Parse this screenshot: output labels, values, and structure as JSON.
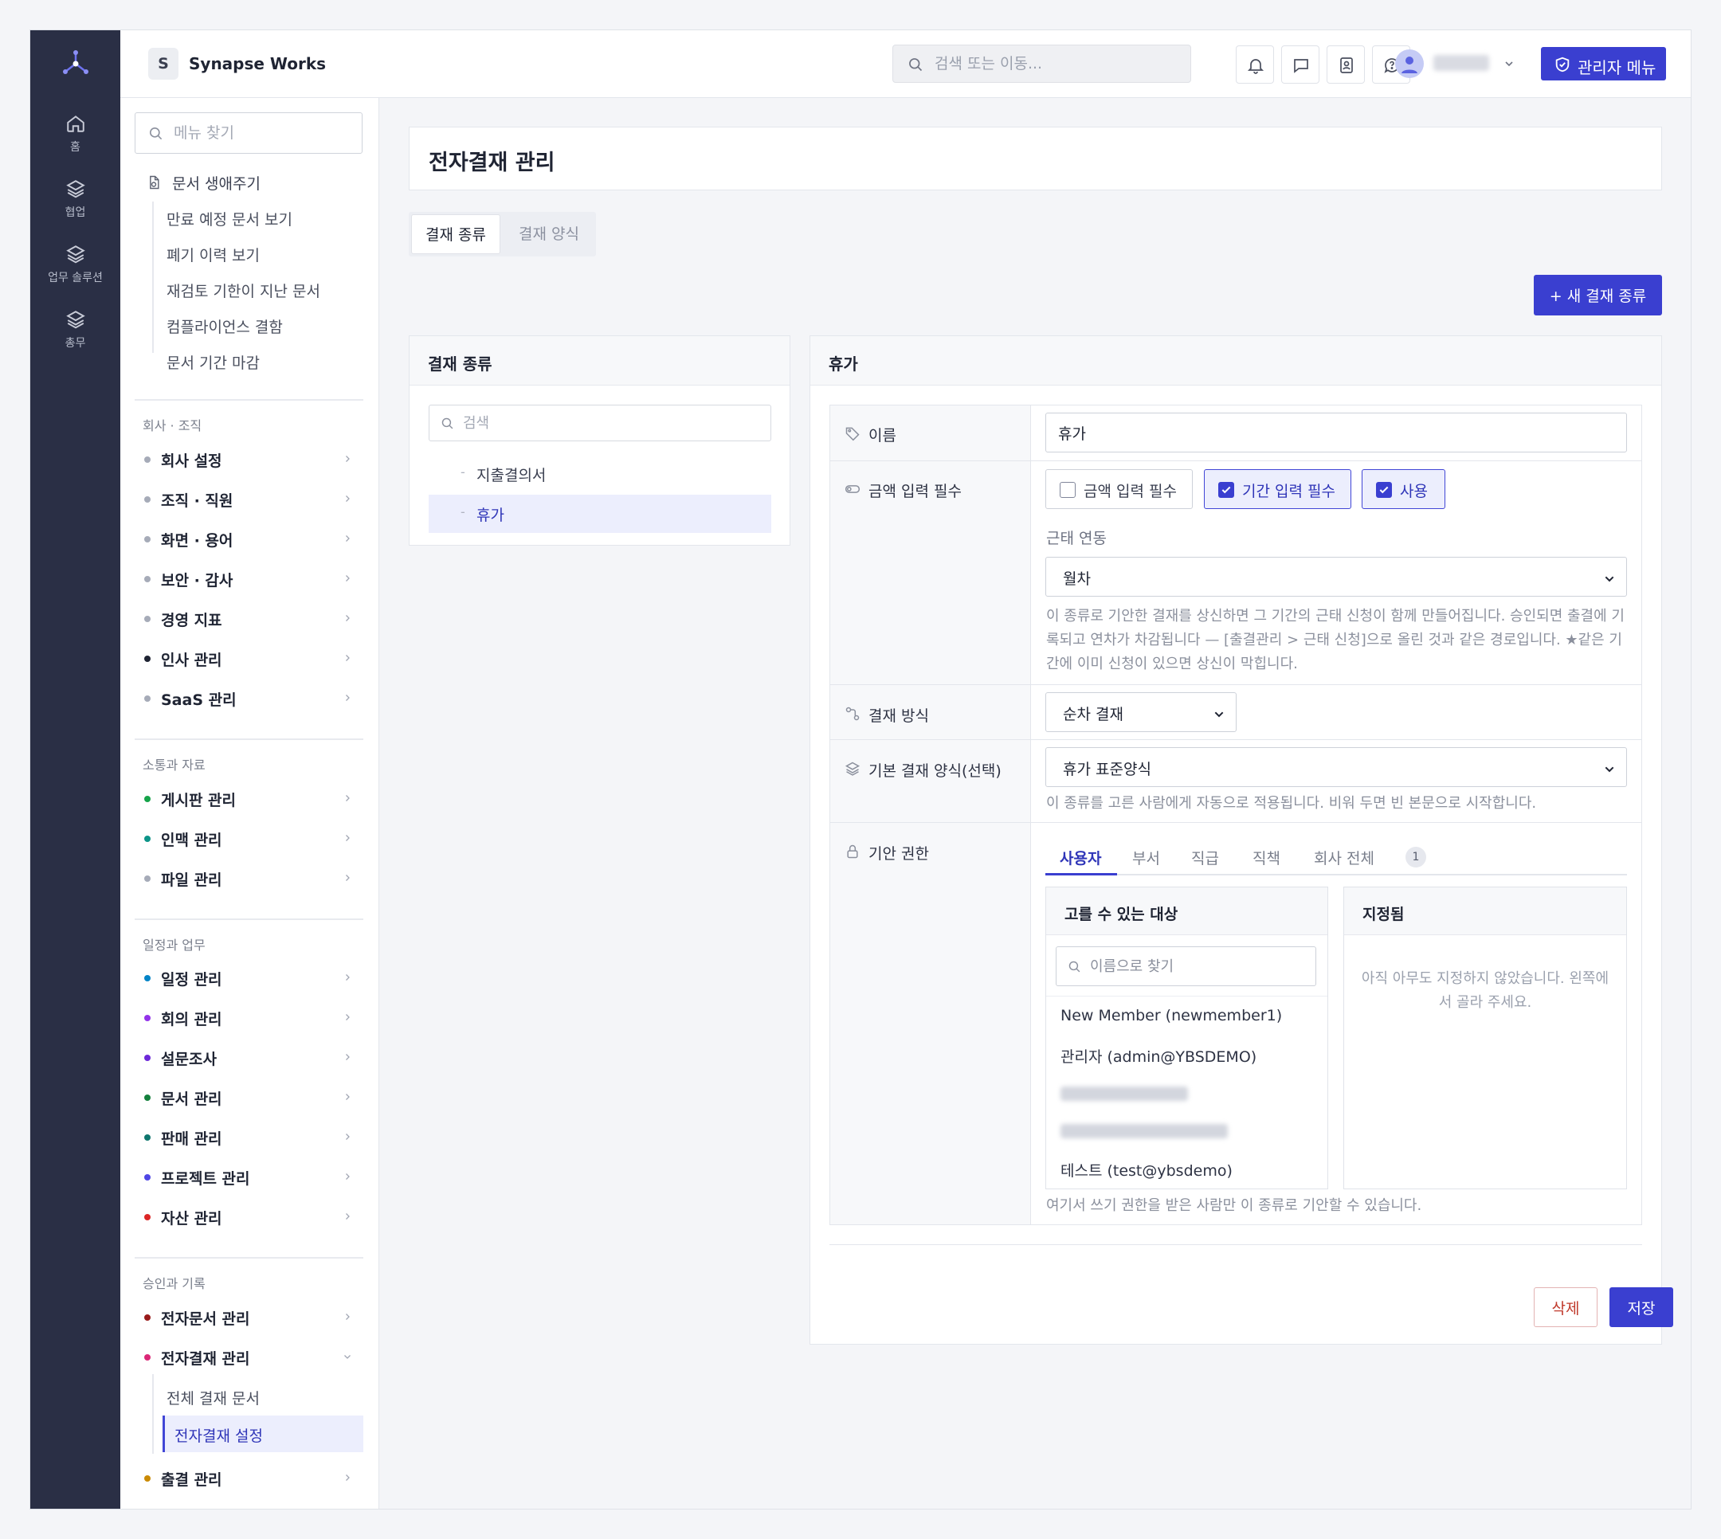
{
  "rail": {
    "items": [
      {
        "label": "홈",
        "icon": "home-icon"
      },
      {
        "label": "협업",
        "icon": "layers-icon"
      },
      {
        "label": "업무 솔루션",
        "icon": "layers-icon"
      },
      {
        "label": "총무",
        "icon": "layers-icon"
      }
    ]
  },
  "header": {
    "org_initial": "S",
    "org_name": "Synapse Works",
    "search_placeholder": "검색 또는 이동...",
    "admin_menu_label": "관리자 메뉴"
  },
  "sidebar": {
    "search_placeholder": "메뉴 찾기",
    "lifecycle": {
      "title": "문서 생애주기",
      "items": [
        "만료 예정 문서 보기",
        "폐기 이력 보기",
        "재검토 기한이 지난 문서",
        "컴플라이언스 결함",
        "문서 기간 마감"
      ]
    },
    "groups": [
      {
        "title": "회사 · 조직",
        "items": [
          {
            "label": "회사 설정",
            "color": "#a6abb8"
          },
          {
            "label": "조직 · 직원",
            "color": "#a6abb8"
          },
          {
            "label": "화면 · 용어",
            "color": "#a6abb8"
          },
          {
            "label": "보안 · 감사",
            "color": "#a6abb8"
          },
          {
            "label": "경영 지표",
            "color": "#a6abb8"
          },
          {
            "label": "인사 관리",
            "color": "#1f2433"
          },
          {
            "label": "SaaS 관리",
            "color": "#a6abb8"
          }
        ]
      },
      {
        "title": "소통과 자료",
        "items": [
          {
            "label": "게시판 관리",
            "color": "#16a34a"
          },
          {
            "label": "인맥 관리",
            "color": "#0d9488"
          },
          {
            "label": "파일 관리",
            "color": "#a6abb8"
          }
        ]
      },
      {
        "title": "일정과 업무",
        "items": [
          {
            "label": "일정 관리",
            "color": "#0284c7"
          },
          {
            "label": "회의 관리",
            "color": "#9333ea"
          },
          {
            "label": "설문조사",
            "color": "#6d28d9"
          },
          {
            "label": "문서 관리",
            "color": "#15803d"
          },
          {
            "label": "판매 관리",
            "color": "#0f766e"
          },
          {
            "label": "프로젝트 관리",
            "color": "#4f46e5"
          },
          {
            "label": "자산 관리",
            "color": "#dc2626"
          }
        ]
      },
      {
        "title": "승인과 기록",
        "items": [
          {
            "label": "전자문서 관리",
            "color": "#991b1b"
          },
          {
            "label": "전자결재 관리",
            "color": "#db2777"
          },
          {
            "label": "출결 관리",
            "color": "#ca8a04"
          }
        ]
      }
    ],
    "approval_sub": [
      "전체 결재 문서",
      "전자결재 설정"
    ]
  },
  "main": {
    "title": "전자결재 관리",
    "tabs": [
      "결재 종류",
      "결재 양식"
    ],
    "new_type_button": "+ 새 결재 종류",
    "type_list": {
      "title": "결재 종류",
      "search_placeholder": "검색",
      "items": [
        "지출결의서",
        "휴가"
      ],
      "dash": "-"
    },
    "detail": {
      "title": "휴가",
      "fields": {
        "name_label": "이름",
        "name_value": "휴가",
        "amount_label": "금액 입력 필수",
        "checks": [
          {
            "label": "금액 입력 필수",
            "checked": false
          },
          {
            "label": "기간 입력 필수",
            "checked": true
          },
          {
            "label": "사용",
            "checked": true
          }
        ],
        "attendance_label": "근태 연동",
        "attendance_value": "월차",
        "attendance_help": "이 종류로 기안한 결재를 상신하면 그 기간의 근태 신청이 함께 만들어집니다. 승인되면 출결에 기록되고 연차가 차감됩니다 — [출결관리 > 근태 신청]으로 올린 것과 같은 경로입니다. ★같은 기간에 이미 신청이 있으면 상신이 막힙니다.",
        "method_label": "결재 방식",
        "method_value": "순차 결재",
        "template_label": "기본 결재 양식(선택)",
        "template_value": "휴가 표준양식",
        "template_help": "이 종류를 고른 사람에게 자동으로 적용됩니다. 비워 두면 빈 본문으로 시작합니다.",
        "permission_label": "기안 권한",
        "permission_tabs": [
          "사용자",
          "부서",
          "직급",
          "직책",
          "회사 전체"
        ],
        "company_count": "1",
        "candidates_title": "고를 수 있는 대상",
        "candidates_search_placeholder": "이름으로 찾기",
        "candidates": [
          "New Member (newmember1)",
          "관리자 (admin@YBSDEMO)",
          "테스트 (test@ybsdemo)"
        ],
        "assigned_title": "지정됨",
        "assigned_empty": "아직 아무도 지정하지 않았습니다. 왼쪽에서 골라 주세요.",
        "permission_help": "여기서 쓰기 권한을 받은 사람만 이 종류로 기안할 수 있습니다."
      },
      "delete_button": "삭제",
      "save_button": "저장"
    }
  },
  "colors": {
    "accent": "#3a3fd0",
    "rail": "#2a2f45",
    "danger": "#c0392b"
  }
}
